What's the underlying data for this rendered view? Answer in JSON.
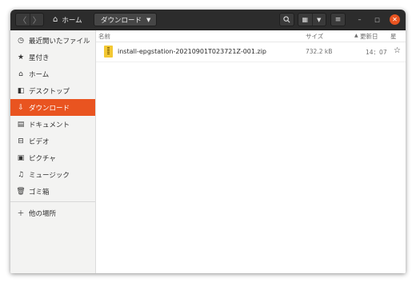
{
  "headerbar": {
    "back_icon": "chevron-left-icon",
    "forward_icon": "chevron-right-icon",
    "home_crumb": "ホーム",
    "current_crumb": "ダウンロード",
    "search_icon": "search-icon",
    "view_icon": "grid-view-icon",
    "view_menu_icon": "chevron-down-icon",
    "menu_icon": "hamburger-menu-icon",
    "minimize_icon": "minimize-icon",
    "maximize_icon": "maximize-icon",
    "close_icon": "close-icon",
    "close_color": "#e95420"
  },
  "sidebar": {
    "items": [
      {
        "label": "最近開いたファイル",
        "icon": "clock-icon"
      },
      {
        "label": "星付き",
        "icon": "star-icon"
      },
      {
        "label": "ホーム",
        "icon": "home-icon"
      },
      {
        "label": "デスクトップ",
        "icon": "desktop-icon"
      },
      {
        "label": "ダウンロード",
        "icon": "download-icon",
        "active": true
      },
      {
        "label": "ドキュメント",
        "icon": "document-icon"
      },
      {
        "label": "ビデオ",
        "icon": "video-icon"
      },
      {
        "label": "ピクチャ",
        "icon": "picture-icon"
      },
      {
        "label": "ミュージック",
        "icon": "music-icon"
      },
      {
        "label": "ゴミ箱",
        "icon": "trash-icon"
      }
    ],
    "other_locations": {
      "label": "他の場所",
      "icon": "plus-icon"
    },
    "accent_color": "#e95420"
  },
  "file_list": {
    "columns": {
      "name": "名前",
      "size": "サイズ",
      "modified": "更新日",
      "star": "星"
    },
    "sort_indicator_icon": "sort-up-icon",
    "rows": [
      {
        "name": "install-epgstation-20210901T023721Z-001.zip",
        "size": "732.2 kB",
        "modified": "14：07",
        "starred_icon": "star-icon"
      }
    ]
  }
}
